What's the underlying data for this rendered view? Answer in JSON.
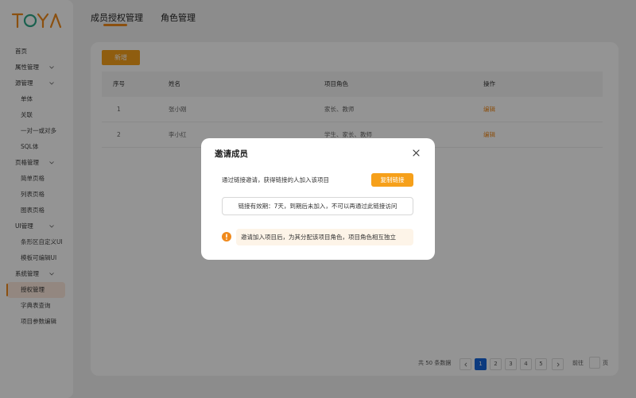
{
  "colors": {
    "accent": "#f08a1d",
    "button": "#f6a01a",
    "page_active": "#1664d9",
    "nav_active_bg": "#fde9dc"
  },
  "logo": {
    "text": "TOYA"
  },
  "sidebar": {
    "items": [
      {
        "label": "首页",
        "expandable": false
      },
      {
        "label": "属性管理",
        "expandable": true
      },
      {
        "label": "源管理",
        "expandable": true
      },
      {
        "label": "单体"
      },
      {
        "label": "关联"
      },
      {
        "label": "一对一或对多"
      },
      {
        "label": "SQL体"
      },
      {
        "label": "页格管理",
        "expandable": true
      },
      {
        "label": "简单页格"
      },
      {
        "label": "列表页格"
      },
      {
        "label": "图表页格"
      },
      {
        "label": "UI管理",
        "expandable": true
      },
      {
        "label": "条形区自定义UI"
      },
      {
        "label": "模板可编辑UI"
      },
      {
        "label": "系统管理",
        "expandable": true
      },
      {
        "label": "授权管理",
        "active": true
      },
      {
        "label": "字典表查询"
      },
      {
        "label": "项目参数编辑"
      }
    ]
  },
  "tabs": [
    {
      "label": "成员授权管理",
      "active": true
    },
    {
      "label": "角色管理",
      "active": false
    }
  ],
  "toolbar": {
    "add_label": "新增"
  },
  "table": {
    "headers": [
      "序号",
      "姓名",
      "项目角色",
      "操作"
    ],
    "rows": [
      {
        "index": "1",
        "name": "张小刚",
        "roles": "家长、教师",
        "action": "编辑"
      },
      {
        "index": "2",
        "name": "李小红",
        "roles": "学生、家长、教师",
        "action": "编辑"
      }
    ]
  },
  "pagination": {
    "total_text": "共 50 条数据",
    "prev_icon": "chevron-left-icon",
    "next_icon": "chevron-right-icon",
    "pages": [
      "1",
      "2",
      "3",
      "4",
      "5"
    ],
    "current": "1",
    "goto_label": "前往",
    "page_suffix": "页"
  },
  "modal": {
    "title": "邀请成员",
    "close_icon": "close-icon",
    "invite_text": "通过链接邀请，获得链接的人加入该项目",
    "copy_label": "复制链接",
    "link_text": "链接有效期：7天，到期后未加入，不可以再通过此链接访问",
    "warn_icon": "warning-icon",
    "warn_text": "邀请加入项目后，为其分配该项目角色，项目角色相互独立"
  }
}
